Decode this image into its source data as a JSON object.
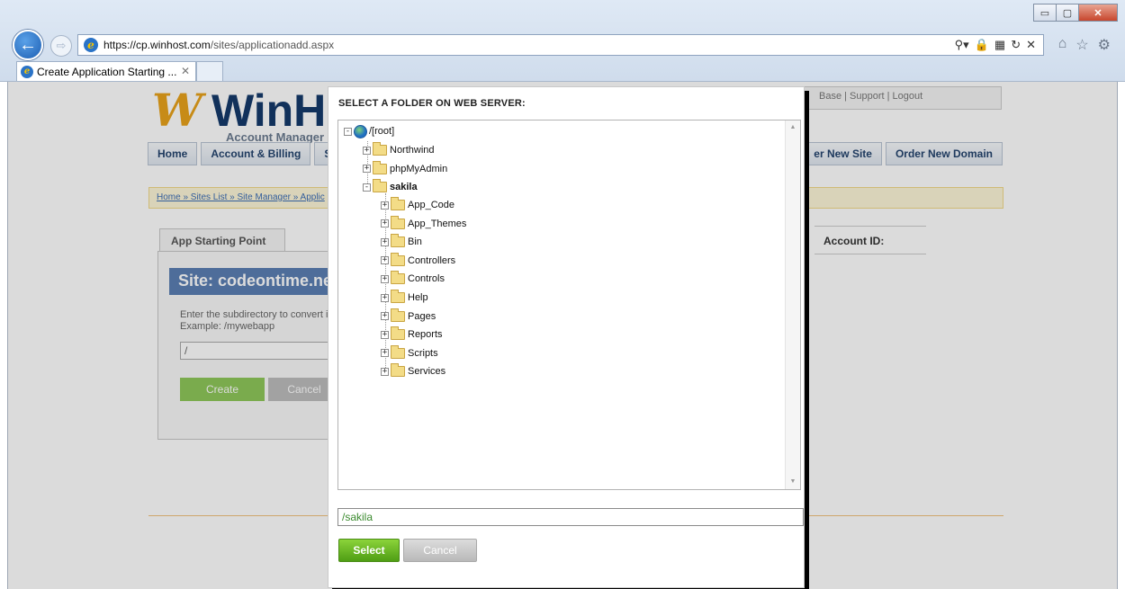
{
  "browser": {
    "address": {
      "protocol": "https://",
      "host": "cp.winhost.com",
      "path": "/sites/applicationadd.aspx"
    },
    "tab_title": "Create Application Starting ...",
    "window_controls": {
      "minimize": "▭",
      "maximize": "▢",
      "close": "✕"
    },
    "icons": [
      "search-icon",
      "lock-icon",
      "compatibility-icon",
      "refresh-icon",
      "stop-icon",
      "home-icon",
      "favorites-icon",
      "settings-icon"
    ]
  },
  "page": {
    "topbar_text": "Base | Support | Logout",
    "logo": {
      "text": "WinH",
      "subtitle": "Account Manager"
    },
    "nav": {
      "home": "Home",
      "account": "Account & Billing",
      "sites": "Sit",
      "order_site": "er New Site",
      "order_domain": "Order New Domain"
    },
    "breadcrumb": "Home » Sites List » Site Manager » Applic",
    "app_tab": "App Starting Point",
    "account_id_label": "Account ID:",
    "site_header": "Site: codeontime.ne",
    "description_line1": "Enter the subdirectory to convert in",
    "description_line2": "Example: /mywebapp",
    "input_value": "/",
    "create_label": "Create",
    "cancel_label": "Cancel"
  },
  "dialog": {
    "title": "SELECT A FOLDER ON WEB SERVER:",
    "root": "/[root]",
    "top_nodes": [
      {
        "label": "Northwind",
        "bold": false
      },
      {
        "label": "phpMyAdmin",
        "bold": false
      },
      {
        "label": "sakila",
        "bold": true
      }
    ],
    "children": [
      "App_Code",
      "App_Themes",
      "Bin",
      "Controllers",
      "Controls",
      "Help",
      "Pages",
      "Reports",
      "Scripts",
      "Services"
    ],
    "path_value": "/sakila",
    "select_label": "Select",
    "cancel_label": "Cancel"
  }
}
